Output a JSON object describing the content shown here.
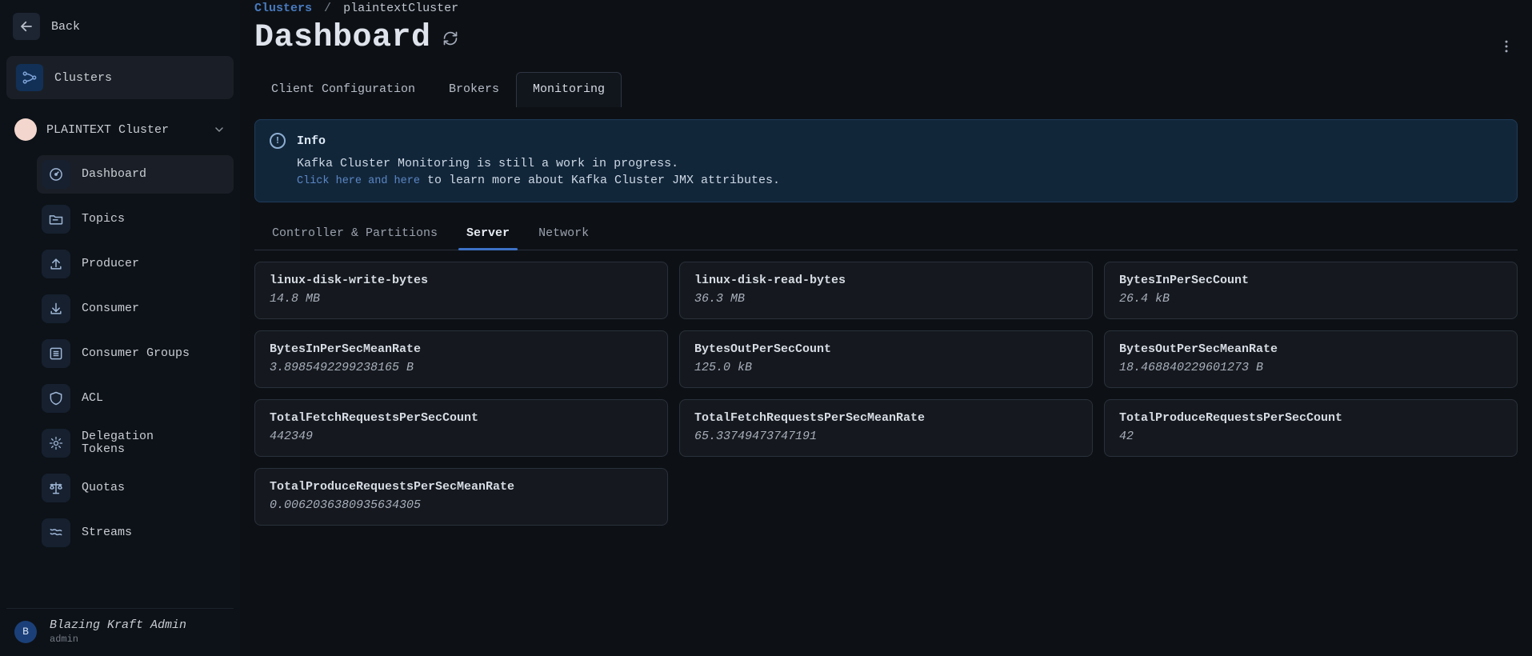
{
  "sidebar": {
    "back_label": "Back",
    "clusters_label": "Clusters",
    "selected_cluster": "PLAINTEXT Cluster",
    "items": [
      {
        "id": "dashboard",
        "label": "Dashboard",
        "active": true
      },
      {
        "id": "topics",
        "label": "Topics",
        "active": false
      },
      {
        "id": "producer",
        "label": "Producer",
        "active": false
      },
      {
        "id": "consumer",
        "label": "Consumer",
        "active": false
      },
      {
        "id": "consumer-groups",
        "label": "Consumer Groups",
        "active": false
      },
      {
        "id": "acl",
        "label": "ACL",
        "active": false
      },
      {
        "id": "delegation-tokens",
        "label": "Delegation\nTokens",
        "active": false
      },
      {
        "id": "quotas",
        "label": "Quotas",
        "active": false
      },
      {
        "id": "streams",
        "label": "Streams",
        "active": false
      }
    ],
    "footer": {
      "avatar_initial": "B",
      "name": "Blazing Kraft Admin",
      "role": "admin"
    }
  },
  "breadcrumb": {
    "root": "Clusters",
    "sep": "/",
    "current": "plaintextCluster"
  },
  "page": {
    "title": "Dashboard"
  },
  "primary_tabs": {
    "items": [
      "Client Configuration",
      "Brokers",
      "Monitoring"
    ],
    "active_index": 2
  },
  "info": {
    "label": "Info",
    "line1": "Kafka Cluster Monitoring is still a work in progress.",
    "link_text": "Click here and here",
    "line2_rest": " to learn more about Kafka Cluster JMX attributes."
  },
  "secondary_tabs": {
    "items": [
      "Controller & Partitions",
      "Server",
      "Network"
    ],
    "active_index": 1
  },
  "metrics": [
    {
      "name": "linux-disk-write-bytes",
      "value": "14.8 MB"
    },
    {
      "name": "linux-disk-read-bytes",
      "value": "36.3 MB"
    },
    {
      "name": "BytesInPerSecCount",
      "value": "26.4 kB"
    },
    {
      "name": "BytesInPerSecMeanRate",
      "value": "3.8985492299238165 B"
    },
    {
      "name": "BytesOutPerSecCount",
      "value": "125.0 kB"
    },
    {
      "name": "BytesOutPerSecMeanRate",
      "value": "18.468840229601273 B"
    },
    {
      "name": "TotalFetchRequestsPerSecCount",
      "value": "442349"
    },
    {
      "name": "TotalFetchRequestsPerSecMeanRate",
      "value": "65.33749473747191"
    },
    {
      "name": "TotalProduceRequestsPerSecCount",
      "value": "42"
    },
    {
      "name": "TotalProduceRequestsPerSecMeanRate",
      "value": "0.0062036380935634305"
    }
  ]
}
